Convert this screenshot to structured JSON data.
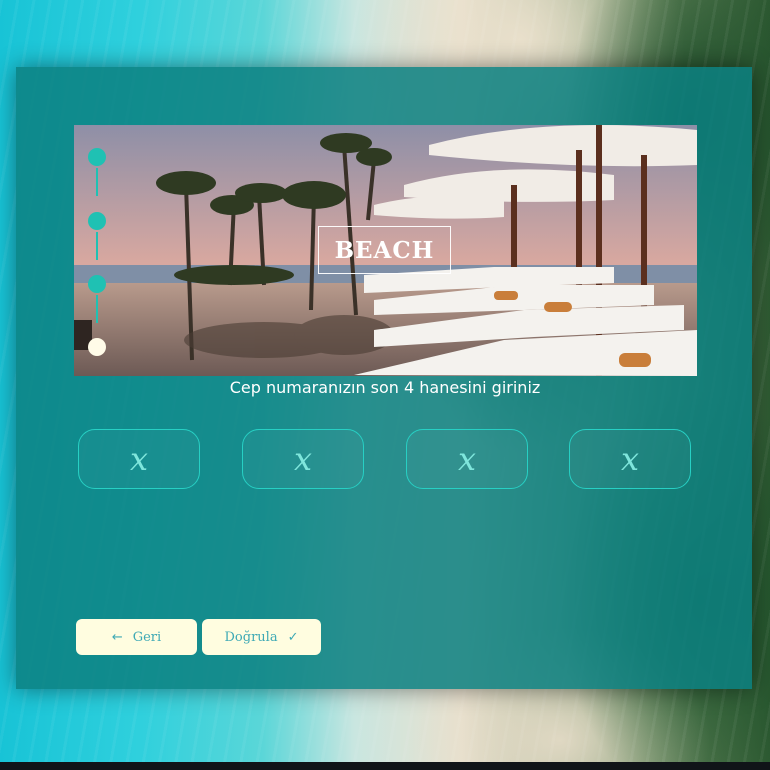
{
  "hero": {
    "label": "BEACH"
  },
  "stepper": {
    "total": 4,
    "active_index": 3
  },
  "prompt": "Cep numaranızın son 4 hanesini giriniz",
  "code_inputs": [
    "x",
    "x",
    "x",
    "x"
  ],
  "buttons": {
    "back": {
      "label": "Geri",
      "icon": "arrow-left-icon"
    },
    "verify": {
      "label": "Doğrula",
      "icon": "check-icon"
    }
  },
  "colors": {
    "panel": "#0c8080",
    "accent": "#1fc1b3",
    "button_bg": "#fffde0",
    "button_text": "#3ea9b5"
  }
}
